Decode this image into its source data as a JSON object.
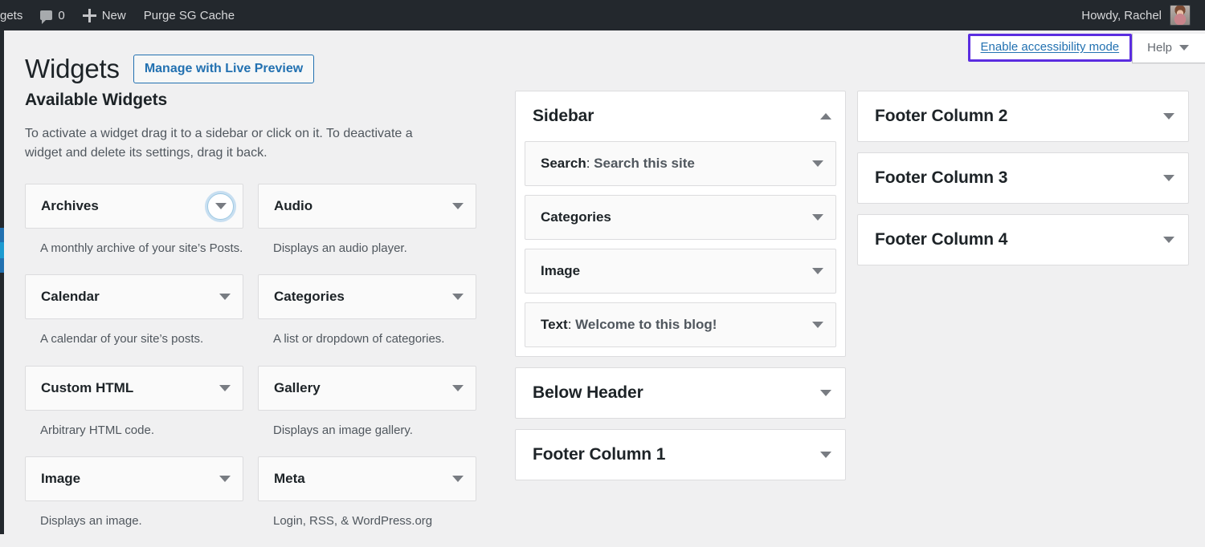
{
  "adminbar": {
    "site_label": "gets",
    "comments_icon": "comment-icon",
    "comments_count": "0",
    "new_icon": "plus-icon",
    "new_label": "New",
    "purge_label": "Purge SG Cache",
    "howdy": "Howdy, Rachel",
    "avatar": "avatar-image"
  },
  "screen_meta": {
    "accessibility_link": "Enable accessibility mode",
    "help_label": "Help",
    "help_caret_icon": "chevron-down-icon",
    "focus_outline_color": "#5b2de0"
  },
  "header": {
    "title": "Widgets",
    "live_preview_button": "Manage with Live Preview"
  },
  "available": {
    "heading": "Available Widgets",
    "description": "To activate a widget drag it to a sidebar or click on it. To deactivate a widget and delete its settings, drag it back.",
    "widgets": [
      {
        "name": "Archives",
        "description": "A monthly archive of your site’s Posts.",
        "caret_icon": "chevron-down-icon",
        "focused": true
      },
      {
        "name": "Audio",
        "description": "Displays an audio player.",
        "caret_icon": "chevron-down-icon",
        "focused": false
      },
      {
        "name": "Calendar",
        "description": "A calendar of your site’s posts.",
        "caret_icon": "chevron-down-icon",
        "focused": false
      },
      {
        "name": "Categories",
        "description": "A list or dropdown of categories.",
        "caret_icon": "chevron-down-icon",
        "focused": false
      },
      {
        "name": "Custom HTML",
        "description": "Arbitrary HTML code.",
        "caret_icon": "chevron-down-icon",
        "focused": false
      },
      {
        "name": "Gallery",
        "description": "Displays an image gallery.",
        "caret_icon": "chevron-down-icon",
        "focused": false
      },
      {
        "name": "Image",
        "description": "Displays an image.",
        "caret_icon": "chevron-down-icon",
        "focused": false
      },
      {
        "name": "Meta",
        "description": "Login, RSS, & WordPress.org",
        "caret_icon": "chevron-down-icon",
        "focused": false
      }
    ]
  },
  "sidebars_middle": [
    {
      "name": "Sidebar",
      "expanded": true,
      "caret_icon": "chevron-up-icon",
      "widgets": [
        {
          "label": "Search",
          "value": "Search this site",
          "caret_icon": "chevron-down-icon"
        },
        {
          "label": "Categories",
          "value": "",
          "caret_icon": "chevron-down-icon"
        },
        {
          "label": "Image",
          "value": "",
          "caret_icon": "chevron-down-icon"
        },
        {
          "label": "Text",
          "value": "Welcome to this blog!",
          "caret_icon": "chevron-down-icon"
        }
      ]
    },
    {
      "name": "Below Header",
      "expanded": false,
      "caret_icon": "chevron-down-icon",
      "widgets": []
    },
    {
      "name": "Footer Column 1",
      "expanded": false,
      "caret_icon": "chevron-down-icon",
      "widgets": []
    }
  ],
  "sidebars_right": [
    {
      "name": "Footer Column 2",
      "expanded": false,
      "caret_icon": "chevron-down-icon",
      "widgets": []
    },
    {
      "name": "Footer Column 3",
      "expanded": false,
      "caret_icon": "chevron-down-icon",
      "widgets": []
    },
    {
      "name": "Footer Column 4",
      "expanded": false,
      "caret_icon": "chevron-down-icon",
      "widgets": []
    }
  ]
}
